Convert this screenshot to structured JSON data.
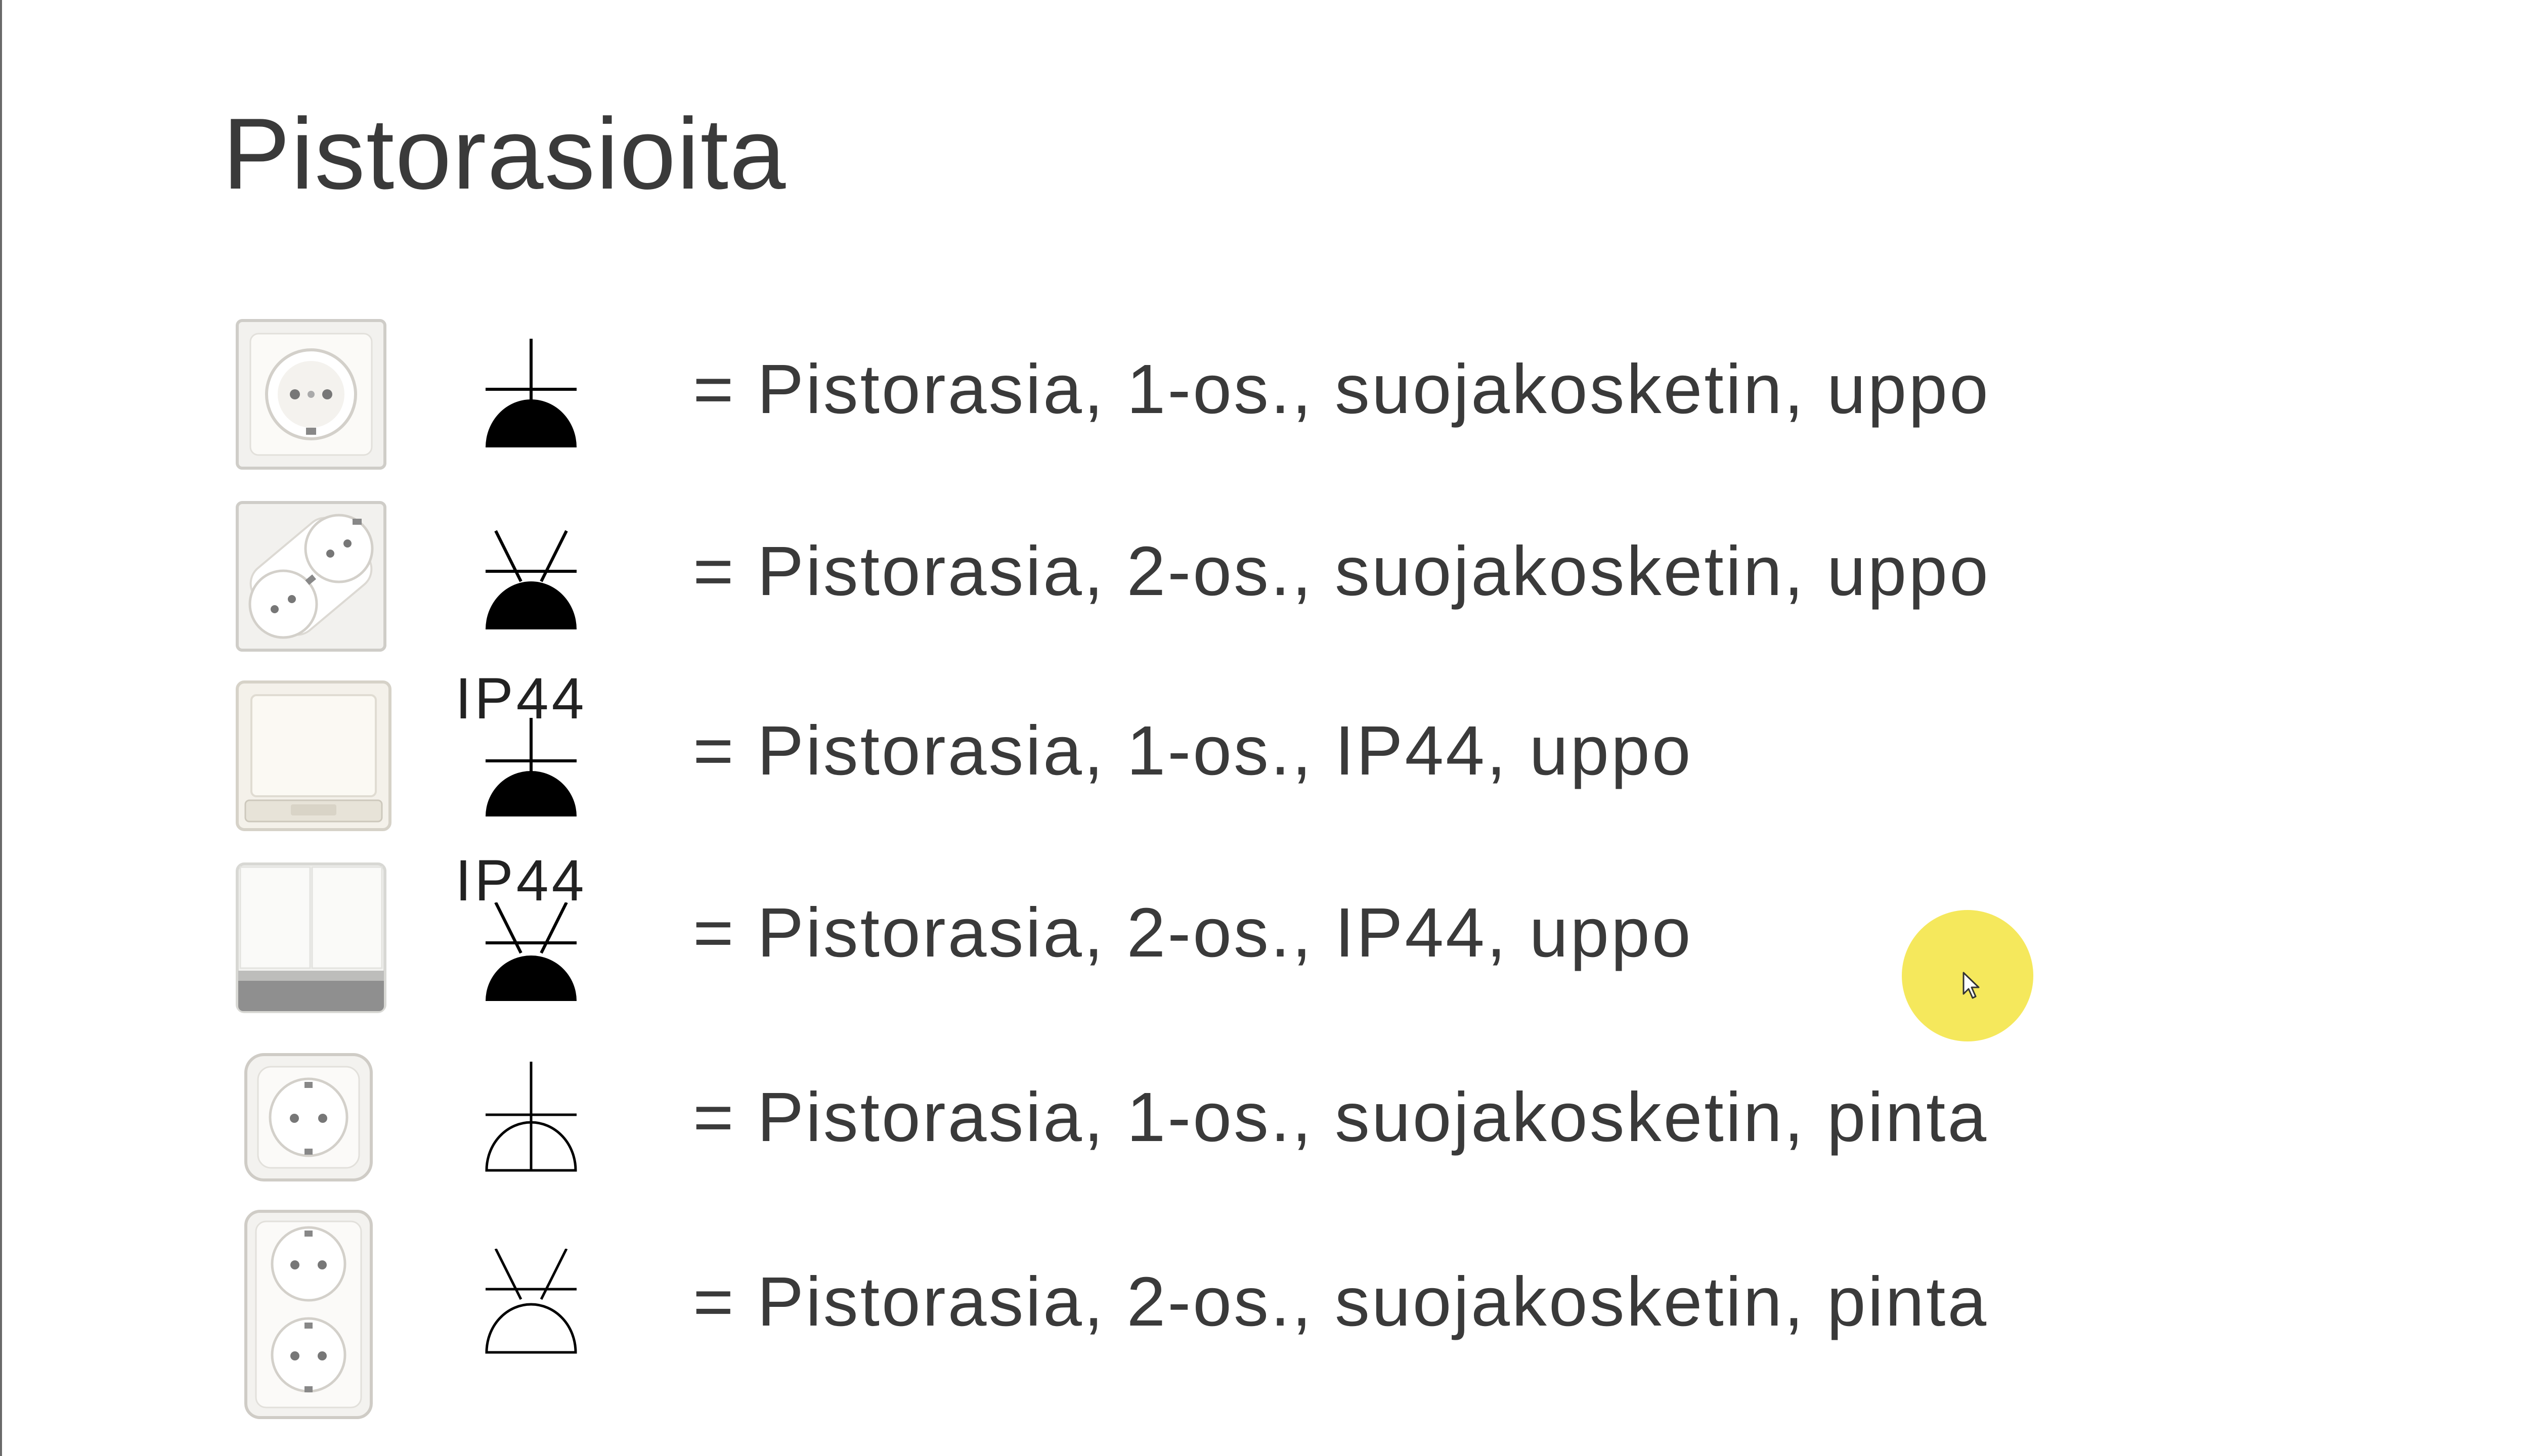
{
  "slide": {
    "title": "Pistorasioita",
    "rows": [
      {
        "symbol": "socket-1-gang-flush",
        "ip_label": "",
        "description": "= Pistorasia, 1-os., suojakosketin, uppo"
      },
      {
        "symbol": "socket-2-gang-flush",
        "ip_label": "",
        "description": "= Pistorasia, 2-os., suojakosketin, uppo"
      },
      {
        "symbol": "socket-1-gang-flush-ip44",
        "ip_label": "IP44",
        "description": "= Pistorasia, 1-os., IP44, uppo"
      },
      {
        "symbol": "socket-2-gang-flush-ip44",
        "ip_label": "IP44",
        "description": "= Pistorasia, 2-os., IP44, uppo"
      },
      {
        "symbol": "socket-1-gang-surface",
        "ip_label": "",
        "description": "= Pistorasia, 1-os., suojakosketin, pinta"
      },
      {
        "symbol": "socket-2-gang-surface",
        "ip_label": "",
        "description": "= Pistorasia, 2-os., suojakosketin, pinta"
      }
    ]
  },
  "colors": {
    "highlight": "#f4e64a",
    "text": "#3a3a3a"
  }
}
